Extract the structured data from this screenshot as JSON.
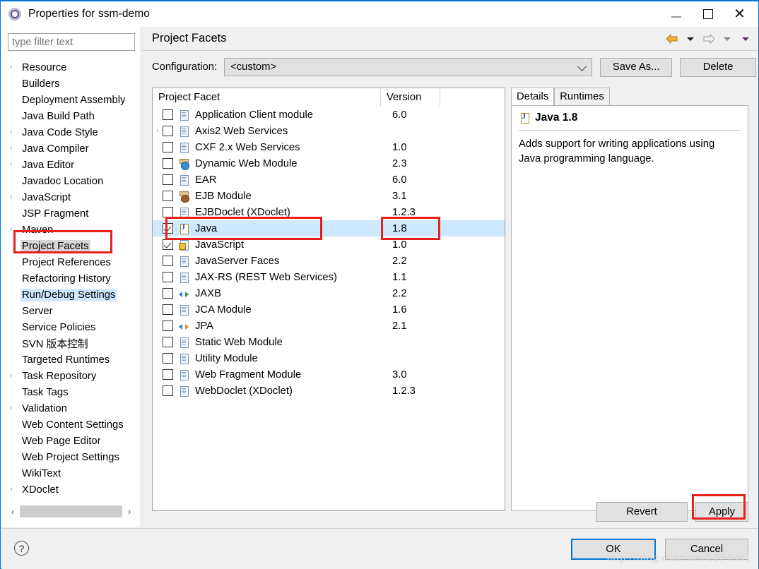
{
  "window": {
    "title": "Properties for ssm-demo",
    "icon": "eclipse-properties-icon",
    "minimize_label": "–",
    "maximize_label": "",
    "close_label": "✕"
  },
  "sidebar": {
    "filter": {
      "value": "",
      "placeholder": "type filter text"
    },
    "items": [
      {
        "label": "Resource",
        "expandable": true,
        "state": "normal"
      },
      {
        "label": "Builders",
        "expandable": false,
        "state": "normal"
      },
      {
        "label": "Deployment Assembly",
        "expandable": false,
        "state": "normal"
      },
      {
        "label": "Java Build Path",
        "expandable": false,
        "state": "normal"
      },
      {
        "label": "Java Code Style",
        "expandable": true,
        "state": "normal"
      },
      {
        "label": "Java Compiler",
        "expandable": true,
        "state": "normal"
      },
      {
        "label": "Java Editor",
        "expandable": true,
        "state": "normal"
      },
      {
        "label": "Javadoc Location",
        "expandable": false,
        "state": "normal"
      },
      {
        "label": "JavaScript",
        "expandable": true,
        "state": "normal"
      },
      {
        "label": "JSP Fragment",
        "expandable": false,
        "state": "normal"
      },
      {
        "label": "Maven",
        "expandable": true,
        "state": "normal"
      },
      {
        "label": "Project Facets",
        "expandable": false,
        "state": "selected-gray"
      },
      {
        "label": "Project References",
        "expandable": false,
        "state": "normal"
      },
      {
        "label": "Refactoring History",
        "expandable": false,
        "state": "normal"
      },
      {
        "label": "Run/Debug Settings",
        "expandable": false,
        "state": "selected-blue"
      },
      {
        "label": "Server",
        "expandable": false,
        "state": "normal"
      },
      {
        "label": "Service Policies",
        "expandable": false,
        "state": "normal"
      },
      {
        "label": "SVN 版本控制",
        "expandable": false,
        "state": "normal"
      },
      {
        "label": "Targeted Runtimes",
        "expandable": false,
        "state": "normal"
      },
      {
        "label": "Task Repository",
        "expandable": true,
        "state": "normal"
      },
      {
        "label": "Task Tags",
        "expandable": false,
        "state": "normal"
      },
      {
        "label": "Validation",
        "expandable": true,
        "state": "normal"
      },
      {
        "label": "Web Content Settings",
        "expandable": false,
        "state": "normal"
      },
      {
        "label": "Web Page Editor",
        "expandable": false,
        "state": "normal"
      },
      {
        "label": "Web Project Settings",
        "expandable": false,
        "state": "normal"
      },
      {
        "label": "WikiText",
        "expandable": false,
        "state": "normal"
      },
      {
        "label": "XDoclet",
        "expandable": true,
        "state": "normal"
      }
    ],
    "scrollbar": {
      "left_arrow": "‹",
      "right_arrow": "›"
    }
  },
  "page": {
    "title": "Project Facets",
    "nav": {
      "back_icon": "back-arrow-icon",
      "back_menu_icon": "chevron-down-icon",
      "forward_icon": "forward-arrow-icon",
      "forward_menu_icon": "chevron-down-icon",
      "view_menu_icon": "chevron-down-icon"
    }
  },
  "configuration": {
    "label": "Configuration:",
    "value": "<custom>",
    "dropdown_icon": "chevron-down-icon",
    "save_as_label": "Save As...",
    "delete_label": "Delete"
  },
  "facets_table": {
    "columns": [
      "Project Facet",
      "Version"
    ],
    "rows": [
      {
        "name": "Application Client module",
        "version": "6.0",
        "checked": false,
        "icon": "doc",
        "expandable": false,
        "dropdown": true,
        "selected": false
      },
      {
        "name": "Axis2 Web Services",
        "version": "",
        "checked": false,
        "icon": "doc",
        "expandable": true,
        "dropdown": false,
        "selected": false
      },
      {
        "name": "CXF 2.x Web Services",
        "version": "1.0",
        "checked": false,
        "icon": "doc",
        "expandable": false,
        "dropdown": false,
        "selected": false
      },
      {
        "name": "Dynamic Web Module",
        "version": "2.3",
        "checked": false,
        "icon": "web",
        "expandable": false,
        "dropdown": true,
        "selected": false
      },
      {
        "name": "EAR",
        "version": "6.0",
        "checked": false,
        "icon": "doc",
        "expandable": false,
        "dropdown": true,
        "selected": false
      },
      {
        "name": "EJB Module",
        "version": "3.1",
        "checked": false,
        "icon": "bean",
        "expandable": false,
        "dropdown": true,
        "selected": false
      },
      {
        "name": "EJBDoclet (XDoclet)",
        "version": "1.2.3",
        "checked": false,
        "icon": "doc",
        "expandable": false,
        "dropdown": true,
        "selected": false
      },
      {
        "name": "Java",
        "version": "1.8",
        "checked": true,
        "icon": "java",
        "expandable": false,
        "dropdown": true,
        "selected": true
      },
      {
        "name": "JavaScript",
        "version": "1.0",
        "checked": true,
        "icon": "jslock",
        "expandable": false,
        "dropdown": false,
        "selected": false
      },
      {
        "name": "JavaServer Faces",
        "version": "2.2",
        "checked": false,
        "icon": "doc",
        "expandable": false,
        "dropdown": true,
        "selected": false
      },
      {
        "name": "JAX-RS (REST Web Services)",
        "version": "1.1",
        "checked": false,
        "icon": "doc",
        "expandable": false,
        "dropdown": true,
        "selected": false
      },
      {
        "name": "JAXB",
        "version": "2.2",
        "checked": false,
        "icon": "arrows",
        "expandable": false,
        "dropdown": true,
        "selected": false
      },
      {
        "name": "JCA Module",
        "version": "1.6",
        "checked": false,
        "icon": "doc",
        "expandable": false,
        "dropdown": true,
        "selected": false
      },
      {
        "name": "JPA",
        "version": "2.1",
        "checked": false,
        "icon": "arrows-orange",
        "expandable": false,
        "dropdown": true,
        "selected": false
      },
      {
        "name": "Static Web Module",
        "version": "",
        "checked": false,
        "icon": "doc",
        "expandable": false,
        "dropdown": false,
        "selected": false
      },
      {
        "name": "Utility Module",
        "version": "",
        "checked": false,
        "icon": "doc",
        "expandable": false,
        "dropdown": false,
        "selected": false
      },
      {
        "name": "Web Fragment Module",
        "version": "3.0",
        "checked": false,
        "icon": "doc",
        "expandable": false,
        "dropdown": true,
        "selected": false
      },
      {
        "name": "WebDoclet (XDoclet)",
        "version": "1.2.3",
        "checked": false,
        "icon": "doc",
        "expandable": false,
        "dropdown": true,
        "selected": false
      }
    ]
  },
  "details": {
    "tabs": [
      {
        "label": "Details",
        "active": true
      },
      {
        "label": "Runtimes",
        "active": false
      }
    ],
    "facet_title": "Java 1.8",
    "facet_icon": "java-facet-icon",
    "description": "Adds support for writing applications using Java programming language."
  },
  "actions": {
    "revert_label": "Revert",
    "apply_label": "Apply",
    "ok_label": "OK",
    "cancel_label": "Cancel",
    "help_label": "?"
  },
  "annotations": {
    "color": "#e8201a",
    "boxes": [
      "sidebar-project-facets",
      "java-row",
      "java-version",
      "apply-button"
    ]
  },
  "watermark": "http://blog.csdn.net/LFF1991"
}
